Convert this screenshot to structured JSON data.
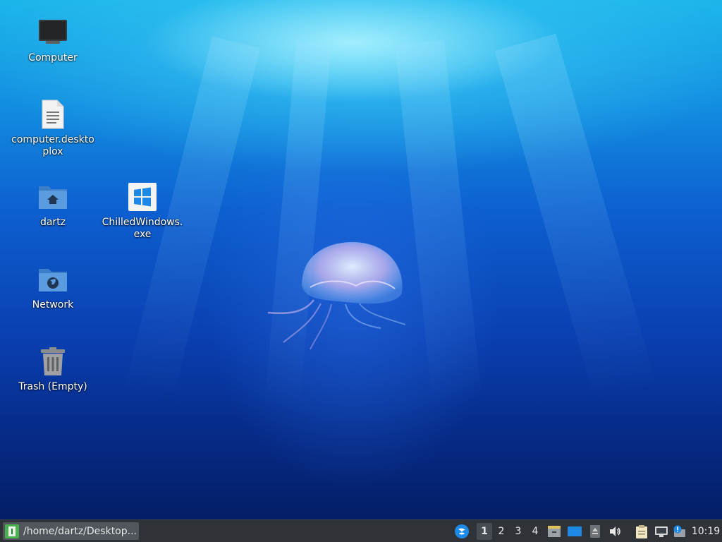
{
  "desktop": {
    "icons": [
      {
        "label": "Computer",
        "icon": "computer-icon"
      },
      {
        "label": "computer.desktoplox",
        "icon": "text-file-icon"
      },
      {
        "label": "dartz",
        "icon": "home-folder-icon"
      },
      {
        "label": "ChilledWindows.exe",
        "icon": "windows-exe-icon"
      },
      {
        "label": "Network",
        "icon": "network-folder-icon"
      },
      {
        "label": "Trash (Empty)",
        "icon": "trash-icon"
      }
    ]
  },
  "taskbar": {
    "task_label": "/home/dartz/Desktop...",
    "workspaces": [
      "1",
      "2",
      "3",
      "4"
    ],
    "active_workspace": "1",
    "clock": "10:19",
    "colors": {
      "background": "#2f3337",
      "accent": "#1e88e5"
    }
  }
}
